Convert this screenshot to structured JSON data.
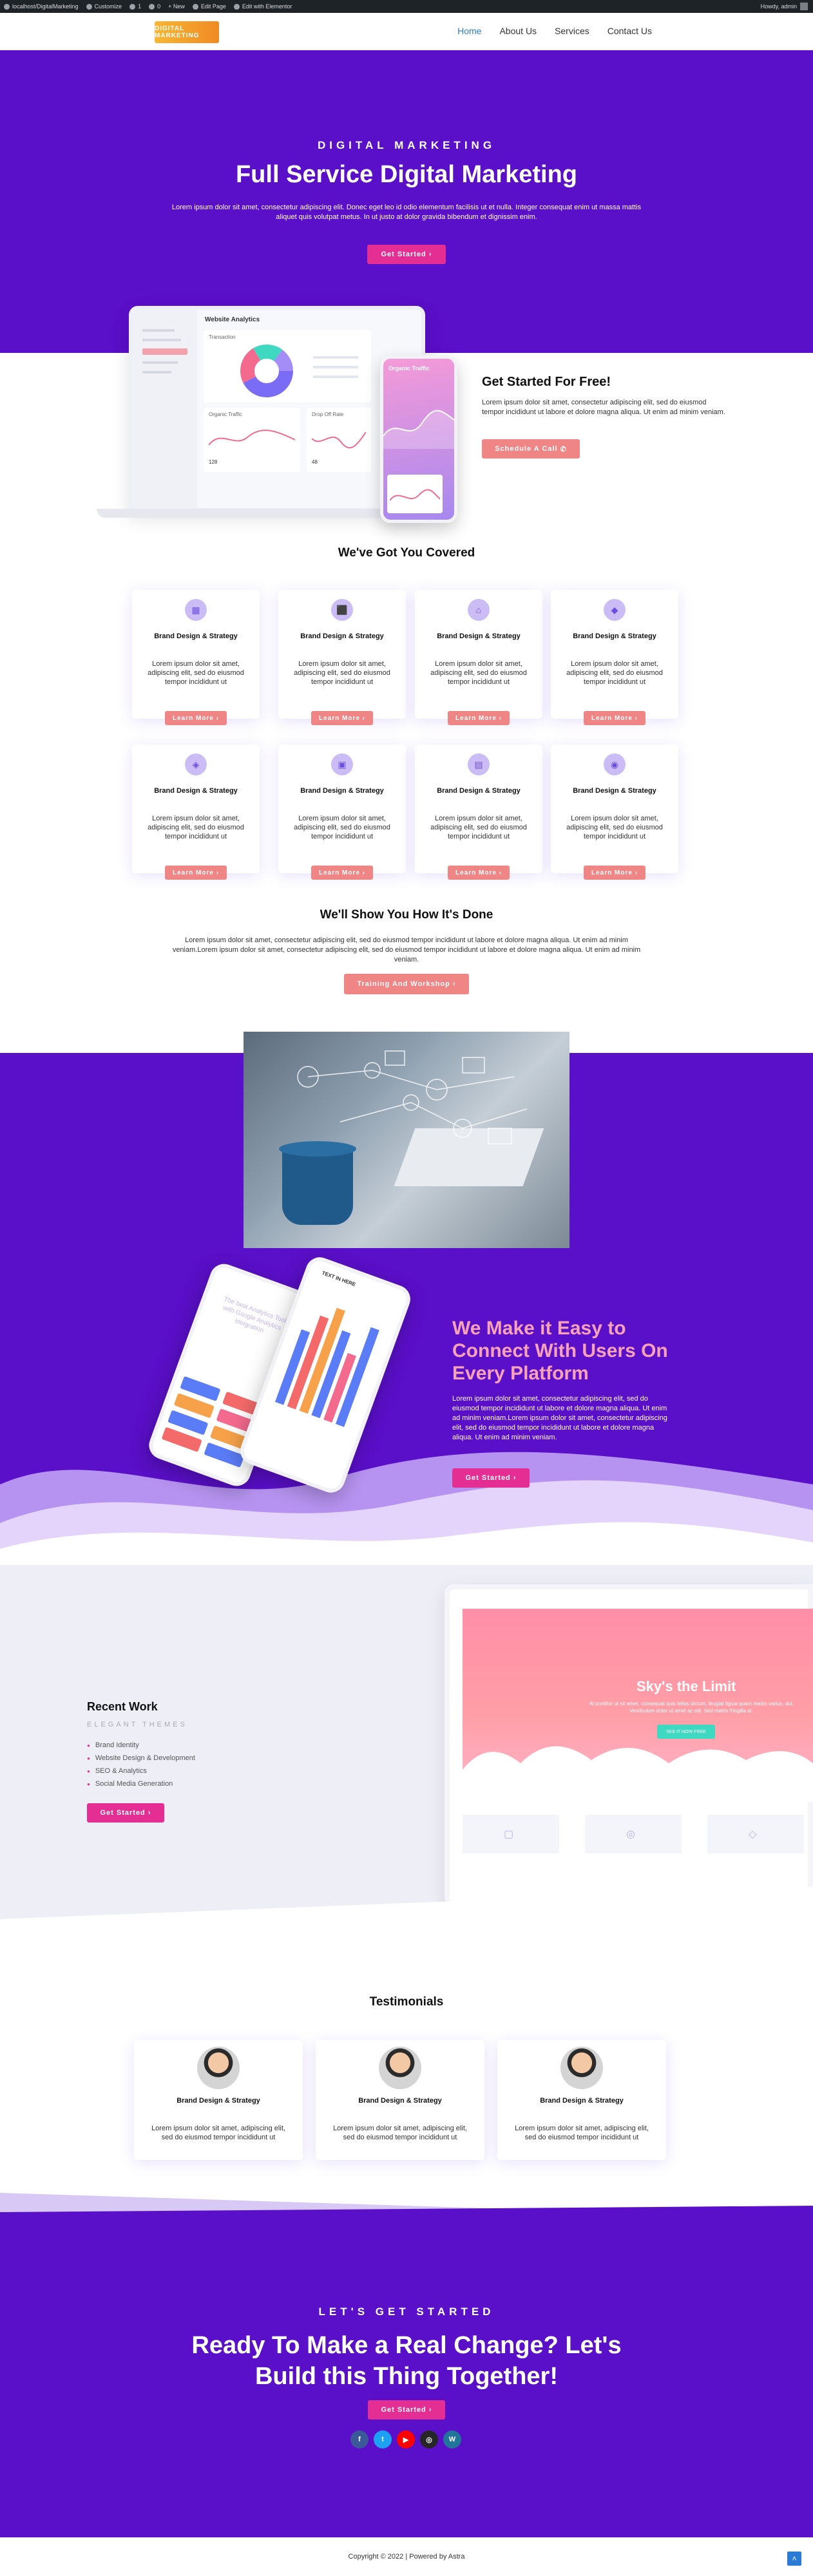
{
  "admin_bar": {
    "site": "localhost/DigitalMarketing",
    "customize": "Customize",
    "comments": "1",
    "updates": "0",
    "new": "+ New",
    "edit_page": "Edit Page",
    "edit_elementor": "Edit with Elementor",
    "howdy": "Howdy, admin"
  },
  "header": {
    "logo": "DIGITAL MARKETING",
    "nav": [
      "Home",
      "About Us",
      "Services",
      "Contact Us"
    ]
  },
  "hero": {
    "eyebrow": "DIGITAL MARKETING",
    "title": "Full Service Digital Marketing",
    "text": "Lorem ipsum dolor sit amet, consectetur adipiscing elit. Donec eget leo id odio elementum facilisis ut et nulla. Integer consequat enim ut massa mattis aliquet quis volutpat metus. In ut justo at dolor gravida bibendum et dignissim enim.",
    "button": "Get Started"
  },
  "mockup": {
    "dashboard_title": "Website Analytics",
    "traffic_label": "Transaction",
    "organic": "Organic Traffic",
    "drop": "Drop Off Rate",
    "phone_title": "Organic Traffic",
    "stat1": "128",
    "stat2": "48"
  },
  "free": {
    "title": "Get Started For Free!",
    "text": "Lorem ipsum dolor sit amet, consectetur adipiscing elit, sed do eiusmod tempor incididunt ut labore et dolore magna aliqua. Ut enim ad minim veniam.",
    "button": "Schedule A Call"
  },
  "covered": {
    "title": "We've Got You Covered",
    "cards": [
      {
        "icon": "building-icon",
        "glyph": "▦",
        "title": "Brand Design & Strategy",
        "text": "Lorem ipsum dolor sit amet, adipiscing elit, sed do eiusmod tempor incididunt ut",
        "button": "Learn More"
      },
      {
        "icon": "lock-icon",
        "glyph": "⬛",
        "title": "Brand Design & Strategy",
        "text": "Lorem ipsum dolor sit amet, adipiscing elit, sed do eiusmod tempor incididunt ut",
        "button": "Learn More"
      },
      {
        "icon": "home-icon",
        "glyph": "⌂",
        "title": "Brand Design & Strategy",
        "text": "Lorem ipsum dolor sit amet, adipiscing elit, sed do eiusmod tempor incididunt ut",
        "button": "Learn More"
      },
      {
        "icon": "tag-icon",
        "glyph": "◆",
        "title": "Brand Design & Strategy",
        "text": "Lorem ipsum dolor sit amet, adipiscing elit, sed do eiusmod tempor incididunt ut",
        "button": "Learn More"
      },
      {
        "icon": "shield-icon",
        "glyph": "◈",
        "title": "Brand Design & Strategy",
        "text": "Lorem ipsum dolor sit amet, adipiscing elit, sed do eiusmod tempor incididunt ut",
        "button": "Learn More"
      },
      {
        "icon": "car-icon",
        "glyph": "▣",
        "title": "Brand Design & Strategy",
        "text": "Lorem ipsum dolor sit amet, adipiscing elit, sed do eiusmod tempor incididunt ut",
        "button": "Learn More"
      },
      {
        "icon": "briefcase-icon",
        "glyph": "▤",
        "title": "Brand Design & Strategy",
        "text": "Lorem ipsum dolor sit amet, adipiscing elit, sed do eiusmod tempor incididunt ut",
        "button": "Learn More"
      },
      {
        "icon": "user-lock-icon",
        "glyph": "◉",
        "title": "Brand Design & Strategy",
        "text": "Lorem ipsum dolor sit amet, adipiscing elit, sed do eiusmod tempor incididunt ut",
        "button": "Learn More"
      }
    ]
  },
  "show": {
    "title": "We'll Show You How It's Done",
    "text": "Lorem ipsum dolor sit amet, consectetur adipiscing elit, sed do eiusmod tempor incididunt ut labore et dolore magna aliqua. Ut enim ad minim veniam.Lorem ipsum dolor sit amet, consectetur adipiscing elit, sed do eiusmod tempor incididunt ut labore et dolore magna aliqua. Ut enim ad minim veniam.",
    "button": "Training And Workshop"
  },
  "connect": {
    "title": "We Make it Easy to Connect With Users On Every Platform",
    "text": "Lorem ipsum dolor sit amet, consectetur adipiscing elit, sed do eiusmod tempor incididunt ut labore et dolore magna aliqua. Ut enim ad minim veniam.Lorem ipsum dolor sit amet, consectetur adipiscing elit, sed do eiusmod tempor incididunt ut labore et dolore magna aliqua. Ut enim ad minim veniam.",
    "button": "Get Started",
    "phone_text": "The best Analytics Tool with Google Analytics Integration",
    "phone_header": "TEXT IN HERE"
  },
  "recent": {
    "title": "Recent Work",
    "subtitle": "ELEGANT THEMES",
    "items": [
      "Brand Identity",
      "Website Design & Development",
      "SEO & Analytics",
      "Social Media Generation"
    ],
    "button": "Get Started",
    "screen_title": "Sky's the Limit",
    "screen_text": "At porttitor ut sit amet, consequat quis tellus dictum, feugiat ligula quam mattis varius, dui. Vestibulum dolor ut amet ac elit. Sed mattis fringilla at.",
    "screen_button": "SEE IT NOW FREE"
  },
  "testimonials": {
    "title": "Testimonials",
    "cards": [
      {
        "title": "Brand Design & Strategy",
        "text": "Lorem ipsum dolor sit amet, adipiscing elit, sed do eiusmod tempor incididunt ut"
      },
      {
        "title": "Brand Design & Strategy",
        "text": "Lorem ipsum dolor sit amet, adipiscing elit, sed do eiusmod tempor incididunt ut"
      },
      {
        "title": "Brand Design & Strategy",
        "text": "Lorem ipsum dolor sit amet, adipiscing elit, sed do eiusmod tempor incididunt ut"
      }
    ]
  },
  "cta": {
    "eyebrow": "LET'S GET STARTED",
    "title": "Ready To Make a Real Change? Let's Build this Thing Together!",
    "button": "Get Started",
    "social": [
      "facebook-icon",
      "twitter-icon",
      "youtube-icon",
      "instagram-icon",
      "wordpress-icon"
    ]
  },
  "footer": {
    "text": "Copyright © 2022 | Powered by Astra"
  },
  "colors": {
    "purple": "#5a0fc8",
    "magenta": "#e52e93",
    "coral": "#f08585",
    "accent_text": "#f7a2b7",
    "nav_active": "#2b7bd6"
  }
}
